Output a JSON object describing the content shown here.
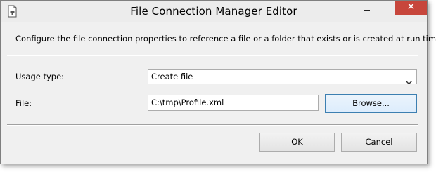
{
  "window": {
    "title": "File Connection Manager Editor",
    "close_glyph": "✕"
  },
  "description": "Configure the file connection properties to reference a file or a folder that exists or is created at run time.",
  "form": {
    "usage_type_label": "Usage type:",
    "usage_type_value": "Create file",
    "file_label": "File:",
    "file_value": "C:\\tmp\\Profile.xml",
    "browse_label": "Browse..."
  },
  "buttons": {
    "ok_label": "OK",
    "cancel_label": "Cancel"
  },
  "colors": {
    "close_button": "#c7463c",
    "focus_border": "#3c7fb1"
  },
  "icons": {
    "title": "file-connection-icon",
    "minimize": "minimize-icon",
    "close": "close-icon",
    "dropdown": "chevron-down-icon"
  }
}
